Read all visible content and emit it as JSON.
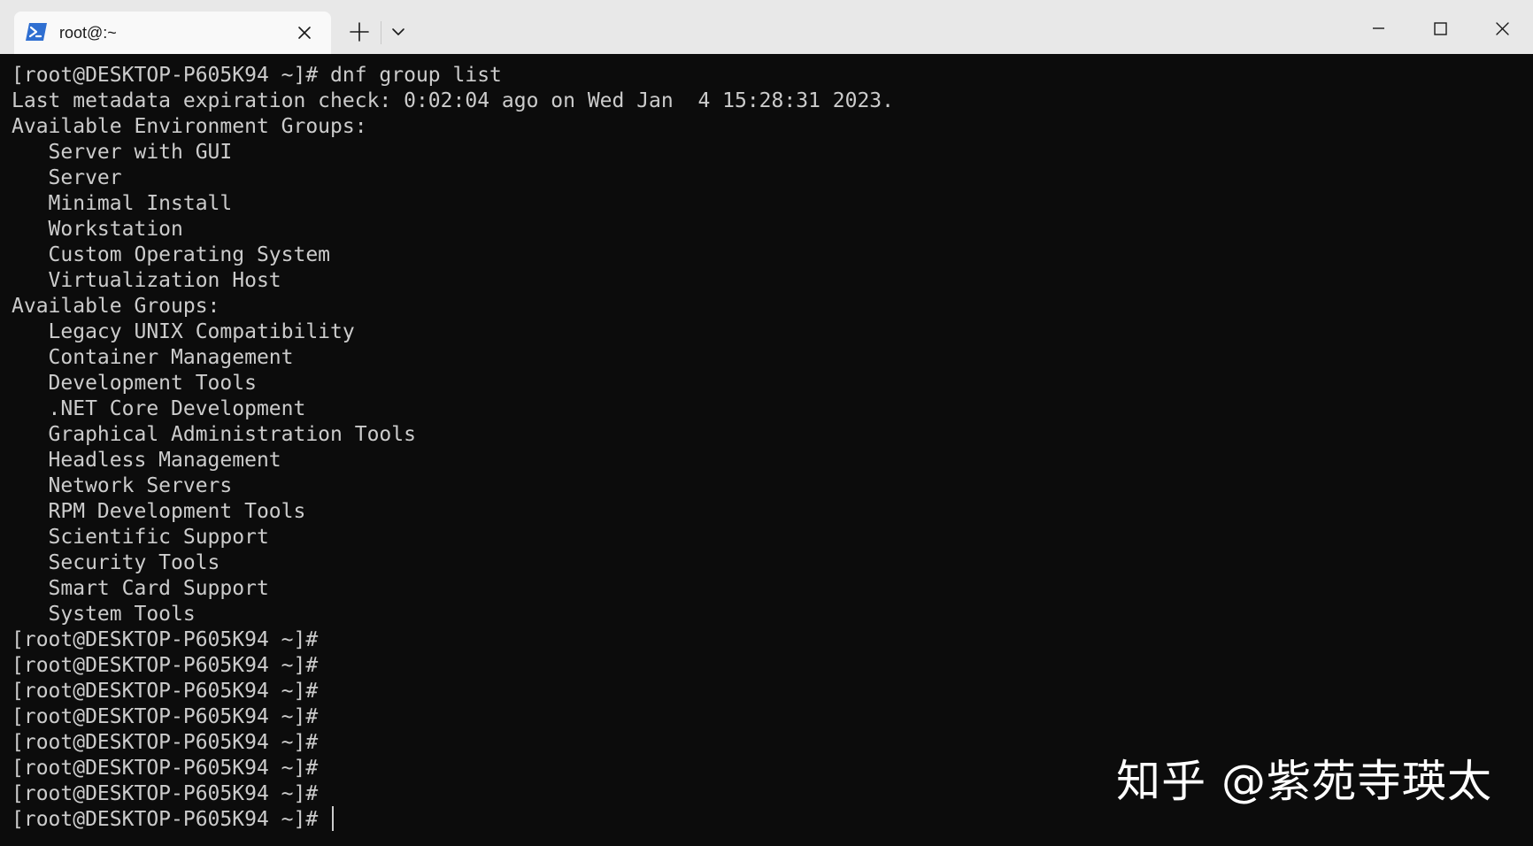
{
  "window": {
    "tab_title": "root@:~",
    "icons": {
      "tab": "terminal-powershell-icon",
      "close_tab": "close-icon",
      "new_tab": "plus-icon",
      "dropdown": "chevron-down-icon",
      "minimize": "minimize-icon",
      "maximize": "maximize-icon",
      "close": "close-icon"
    },
    "colors": {
      "titlebar": "#e8e8e8",
      "tab": "#f9f9f9",
      "terminal_bg": "#0c0c0c",
      "terminal_fg": "#cccccc",
      "icon_accent": "#2f6fd1"
    }
  },
  "terminal": {
    "lines": [
      "[root@DESKTOP-P605K94 ~]# dnf group list",
      "Last metadata expiration check: 0:02:04 ago on Wed Jan  4 15:28:31 2023.",
      "Available Environment Groups:",
      "   Server with GUI",
      "   Server",
      "   Minimal Install",
      "   Workstation",
      "   Custom Operating System",
      "   Virtualization Host",
      "Available Groups:",
      "   Legacy UNIX Compatibility",
      "   Container Management",
      "   Development Tools",
      "   .NET Core Development",
      "   Graphical Administration Tools",
      "   Headless Management",
      "   Network Servers",
      "   RPM Development Tools",
      "   Scientific Support",
      "   Security Tools",
      "   Smart Card Support",
      "   System Tools",
      "[root@DESKTOP-P605K94 ~]#",
      "[root@DESKTOP-P605K94 ~]#",
      "[root@DESKTOP-P605K94 ~]#",
      "[root@DESKTOP-P605K94 ~]#",
      "[root@DESKTOP-P605K94 ~]#",
      "[root@DESKTOP-P605K94 ~]#",
      "[root@DESKTOP-P605K94 ~]#"
    ],
    "prompt": "[root@DESKTOP-P605K94 ~]# "
  },
  "watermark": "知乎 @紫苑寺瑛太"
}
